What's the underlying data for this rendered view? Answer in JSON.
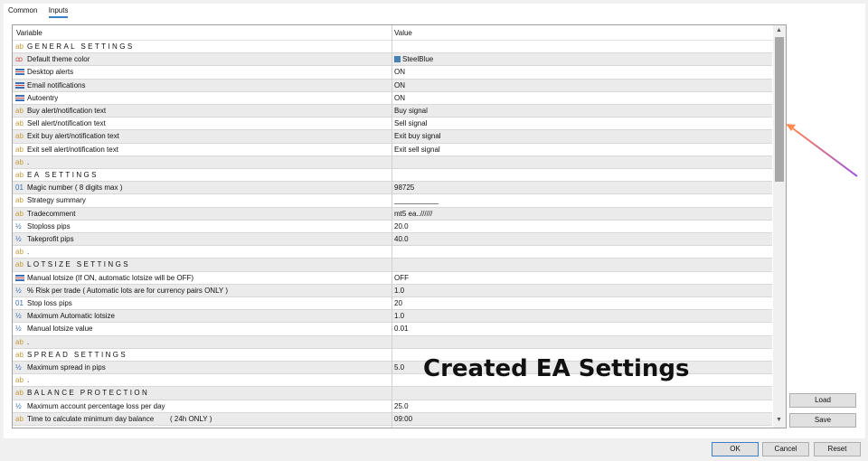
{
  "tabs": [
    "Common",
    "Inputs"
  ],
  "columns": {
    "variable": "Variable",
    "value": "Value"
  },
  "rows": [
    {
      "icon": "ab",
      "label": "GENERAL SETTINGS",
      "value": "",
      "section": true
    },
    {
      "icon": "color",
      "label": "Default theme color",
      "value": "SteelBlue",
      "swatch": "#4682b4"
    },
    {
      "icon": "bool",
      "label": "Desktop alerts",
      "value": "ON"
    },
    {
      "icon": "bool",
      "label": "Email notifications",
      "value": "ON"
    },
    {
      "icon": "bool",
      "label": "Autoentry",
      "value": "ON"
    },
    {
      "icon": "ab",
      "label": "Buy alert/notification text",
      "value": "Buy signal"
    },
    {
      "icon": "ab",
      "label": "Sell alert/notification text",
      "value": "Sell signal"
    },
    {
      "icon": "ab",
      "label": "Exit buy alert/notification text",
      "value": "Exit buy signal"
    },
    {
      "icon": "ab",
      "label": "Exit sell alert/notification text",
      "value": "Exit sell signal"
    },
    {
      "icon": "ab",
      "label": ".",
      "value": ""
    },
    {
      "icon": "ab",
      "label": "EA SETTINGS",
      "value": "",
      "section": true
    },
    {
      "icon": "int",
      "label": "Magic number ( 8 digits max )",
      "value": "98725"
    },
    {
      "icon": "ab",
      "label": "Strategy summary",
      "value": "___________"
    },
    {
      "icon": "ab",
      "label": "Tradecomment",
      "value": "mt5 ea..//////"
    },
    {
      "icon": "double",
      "label": "Stoploss pips",
      "value": "20.0"
    },
    {
      "icon": "double",
      "label": "Takeprofit pips",
      "value": "40.0"
    },
    {
      "icon": "ab",
      "label": ".",
      "value": ""
    },
    {
      "icon": "ab",
      "label": "LOTSIZE SETTINGS",
      "value": "",
      "section": true
    },
    {
      "icon": "bool",
      "label": "Manual lotsize (If ON, automatic lotsize will be OFF)",
      "value": "OFF"
    },
    {
      "icon": "double",
      "label": "% Risk per trade ( Automatic lots are for currency pairs ONLY )",
      "value": "1.0"
    },
    {
      "icon": "int",
      "label": "Stop loss pips",
      "value": "20"
    },
    {
      "icon": "double",
      "label": "Maximum Automatic lotsize",
      "value": "1.0"
    },
    {
      "icon": "double",
      "label": "Manual lotsize value",
      "value": "0.01"
    },
    {
      "icon": "ab",
      "label": ".",
      "value": ""
    },
    {
      "icon": "ab",
      "label": "SPREAD SETTINGS",
      "value": "",
      "section": true
    },
    {
      "icon": "double",
      "label": "Maximum spread in pips",
      "value": "5.0"
    },
    {
      "icon": "ab",
      "label": ".",
      "value": ""
    },
    {
      "icon": "ab",
      "label": "BALANCE PROTECTION",
      "value": "",
      "section": true
    },
    {
      "icon": "double",
      "label": "Maximum account percentage loss per day",
      "value": "25.0"
    },
    {
      "icon": "ab",
      "label": "Time to calculate minimum day balance        ( 24h ONLY )",
      "value": "09:00"
    }
  ],
  "buttons": {
    "load": "Load",
    "save": "Save",
    "ok": "OK",
    "cancel": "Cancel",
    "reset": "Reset"
  },
  "overlay_text": "Created EA Settings"
}
